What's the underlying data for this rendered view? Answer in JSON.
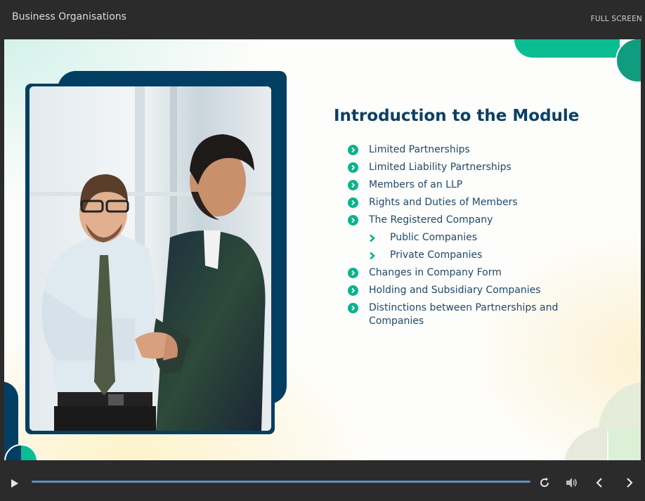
{
  "header": {
    "course_title": "Business Organisations",
    "fullscreen_label": "FULL SCREEN"
  },
  "slide": {
    "heading": "Introduction to the Module",
    "items": [
      {
        "label": "Limited Partnerships",
        "level": 1
      },
      {
        "label": "Limited Liability Partnerships",
        "level": 1
      },
      {
        "label": "Members of an LLP",
        "level": 1
      },
      {
        "label": "Rights and Duties of Members",
        "level": 1
      },
      {
        "label": "The Registered Company",
        "level": 1
      },
      {
        "label": "Public Companies",
        "level": 2
      },
      {
        "label": "Private Companies",
        "level": 2
      },
      {
        "label": "Changes in Company Form",
        "level": 1
      },
      {
        "label": "Holding and Subsidiary Companies",
        "level": 1
      },
      {
        "label": "Distinctions between Partnerships and Companies",
        "level": 1
      }
    ],
    "image_description": "two-businessmen-handshake-photo"
  },
  "controls": {
    "play_icon": "play-icon",
    "replay_icon": "replay-icon",
    "volume_icon": "volume-icon",
    "prev_icon": "chevron-left-icon",
    "next_icon": "chevron-right-icon",
    "progress": 0
  },
  "colors": {
    "navy": "#033f63",
    "teal": "#0bbd93",
    "heading": "#0c3f63",
    "text": "#204a6a",
    "chrome": "#2b2b2b",
    "progress_track": "#5e8ec0"
  }
}
